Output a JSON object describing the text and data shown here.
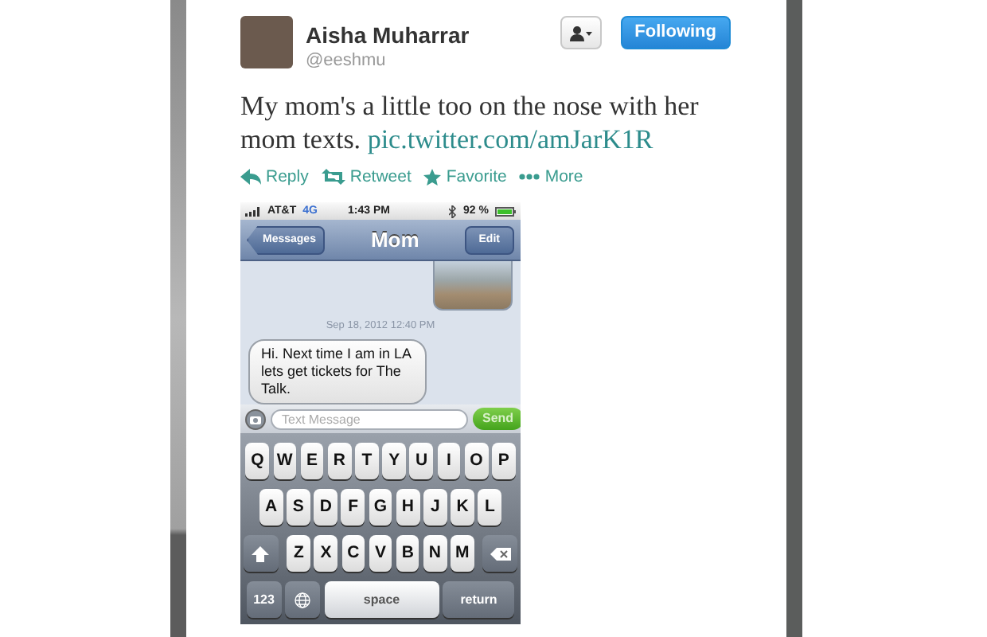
{
  "tweet": {
    "author": {
      "name": "Aisha Muharrar",
      "handle": "@eeshmu"
    },
    "follow_button": {
      "label": "Following"
    },
    "text": "My mom's a little too on the nose with her mom texts.",
    "link": "pic.twitter.com/amJarK1R",
    "actions": [
      {
        "kind": "reply",
        "label": "Reply"
      },
      {
        "kind": "retweet",
        "label": "Retweet"
      },
      {
        "kind": "favorite",
        "label": "Favorite"
      },
      {
        "kind": "more",
        "label": "More"
      }
    ],
    "photo": {
      "status_bar": {
        "carrier": "AT&T",
        "network": "4G",
        "time": "1:43 PM",
        "battery": "92 %"
      },
      "nav": {
        "back": "Messages",
        "title": "Mom",
        "action": "Edit"
      },
      "items": [
        {
          "kind": "image"
        },
        {
          "kind": "timestamp",
          "text": "Sep 18, 2012 12:40 PM"
        },
        {
          "kind": "bubble",
          "text": "Hi.  Next time I am in LA lets get tickets for The Talk."
        }
      ],
      "input": {
        "placeholder": "Text Message",
        "send": "Send"
      },
      "keyboard": [
        [
          {
            "kind": "letter",
            "label": "Q"
          },
          {
            "kind": "letter",
            "label": "W"
          },
          {
            "kind": "letter",
            "label": "E"
          },
          {
            "kind": "letter",
            "label": "R"
          },
          {
            "kind": "letter",
            "label": "T"
          },
          {
            "kind": "letter",
            "label": "Y"
          },
          {
            "kind": "letter",
            "label": "U"
          },
          {
            "kind": "letter",
            "label": "I"
          },
          {
            "kind": "letter",
            "label": "O"
          },
          {
            "kind": "letter",
            "label": "P"
          }
        ],
        [
          {
            "kind": "letter",
            "label": "A"
          },
          {
            "kind": "letter",
            "label": "S"
          },
          {
            "kind": "letter",
            "label": "D"
          },
          {
            "kind": "letter",
            "label": "F"
          },
          {
            "kind": "letter",
            "label": "G"
          },
          {
            "kind": "letter",
            "label": "H"
          },
          {
            "kind": "letter",
            "label": "J"
          },
          {
            "kind": "letter",
            "label": "K"
          },
          {
            "kind": "letter",
            "label": "L"
          }
        ],
        [
          {
            "kind": "shift"
          },
          {
            "kind": "letter",
            "label": "Z"
          },
          {
            "kind": "letter",
            "label": "X"
          },
          {
            "kind": "letter",
            "label": "C"
          },
          {
            "kind": "letter",
            "label": "V"
          },
          {
            "kind": "letter",
            "label": "B"
          },
          {
            "kind": "letter",
            "label": "N"
          },
          {
            "kind": "letter",
            "label": "M"
          },
          {
            "kind": "delete"
          }
        ],
        [
          {
            "kind": "mode",
            "label": "123"
          },
          {
            "kind": "globe"
          },
          {
            "kind": "space",
            "label": "space"
          },
          {
            "kind": "return",
            "label": "return"
          }
        ]
      ]
    }
  }
}
